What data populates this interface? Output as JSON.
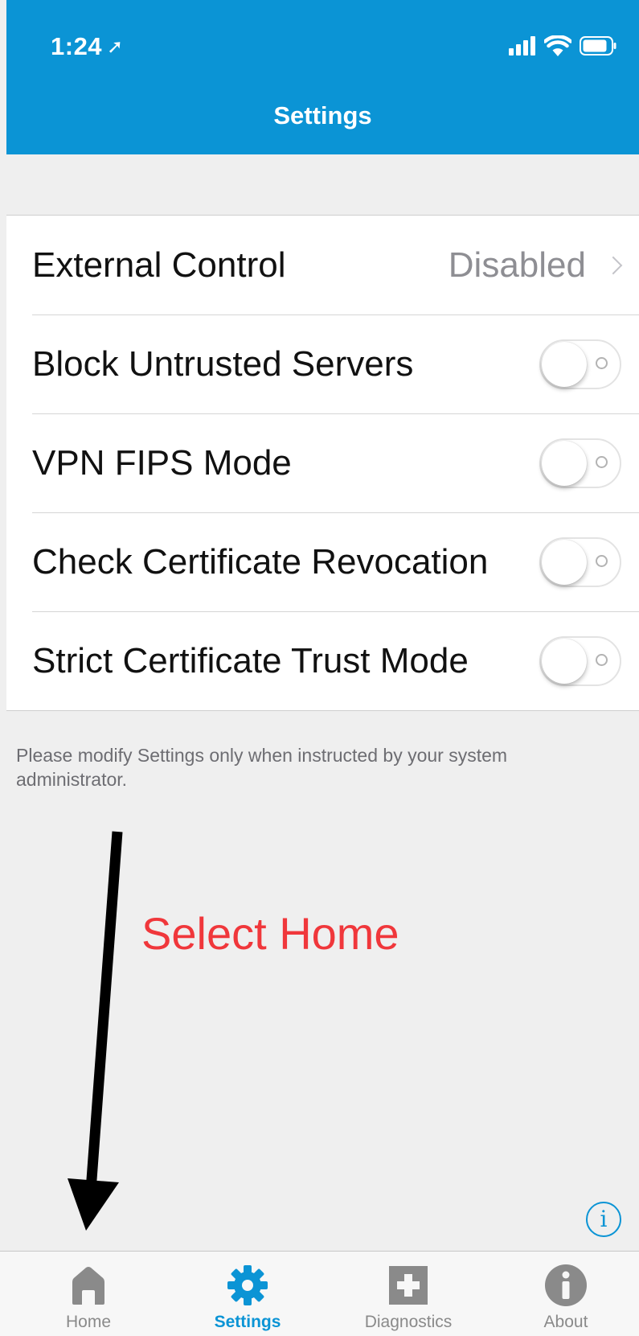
{
  "status_bar": {
    "time": "1:24",
    "location_arrow": "location-arrow-icon",
    "icons": [
      "cellular-signal-icon",
      "wifi-icon",
      "battery-icon"
    ]
  },
  "header": {
    "title": "Settings"
  },
  "settings": {
    "external_control": {
      "label": "External Control",
      "value": "Disabled"
    },
    "block_untrusted_servers": {
      "label": "Block Untrusted Servers",
      "enabled": false
    },
    "vpn_fips_mode": {
      "label": "VPN FIPS Mode",
      "enabled": false
    },
    "check_certificate_revocation": {
      "label": "Check Certificate Revocation",
      "enabled": false
    },
    "strict_certificate_trust_mode": {
      "label": "Strict Certificate Trust Mode",
      "enabled": false
    }
  },
  "footer_note": "Please modify Settings only when instructed by your system administrator.",
  "annotation": {
    "text": "Select Home",
    "text_color": "#f0373b"
  },
  "info_button": {
    "icon": "info-icon",
    "label": "i"
  },
  "tabs": [
    {
      "label": "Home",
      "icon": "home-icon",
      "active": false
    },
    {
      "label": "Settings",
      "icon": "gear-icon",
      "active": true
    },
    {
      "label": "Diagnostics",
      "icon": "diagnostics-plus-icon",
      "active": false
    },
    {
      "label": "About",
      "icon": "about-info-icon",
      "active": false
    }
  ],
  "colors": {
    "accent": "#0b94d5",
    "background": "#efefef",
    "inactive_tab": "#8a8a8a"
  }
}
